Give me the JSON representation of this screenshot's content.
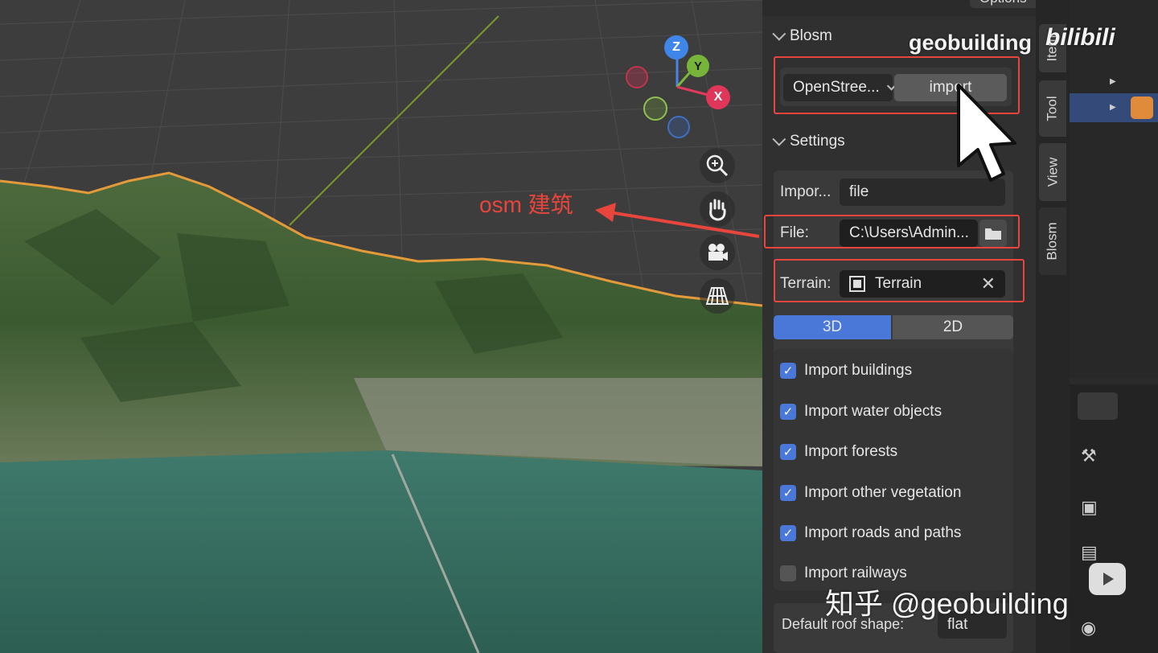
{
  "viewport": {
    "annotation_label": "osm 建筑",
    "gizmo": {
      "x": "X",
      "y": "Y",
      "z": "Z"
    },
    "nav_icons": [
      "zoom-icon",
      "hand-pan-icon",
      "camera-icon",
      "grid-perspective-icon"
    ]
  },
  "top_menu": {
    "options_label": "Options"
  },
  "panel": {
    "blosm_header": "Blosm",
    "source_dropdown": "OpenStree...",
    "import_button": "import",
    "settings_header": "Settings",
    "import_label": "Impor...",
    "import_value": "file",
    "file_label": "File:",
    "file_value": "C:\\Users\\Admin...",
    "terrain_label": "Terrain:",
    "terrain_value": "Terrain",
    "mode_3d": "3D",
    "mode_2d": "2D",
    "checkboxes": [
      {
        "label": "Import buildings",
        "checked": true
      },
      {
        "label": "Import water objects",
        "checked": true
      },
      {
        "label": "Import forests",
        "checked": true
      },
      {
        "label": "Import other vegetation",
        "checked": true
      },
      {
        "label": "Import roads and paths",
        "checked": true
      },
      {
        "label": "Import railways",
        "checked": false
      }
    ],
    "roof_label": "Default roof shape:",
    "roof_value": "flat"
  },
  "tabs": [
    "Item",
    "Tool",
    "View",
    "Blosm"
  ],
  "active_tab": "Blosm",
  "watermarks": {
    "top": "geobuilding",
    "brand": "bilibili",
    "bottom": "知乎 @geobuilding"
  },
  "colors": {
    "accent": "#4a78d8",
    "highlight": "#e8453c",
    "annotation": "#e8453c"
  }
}
